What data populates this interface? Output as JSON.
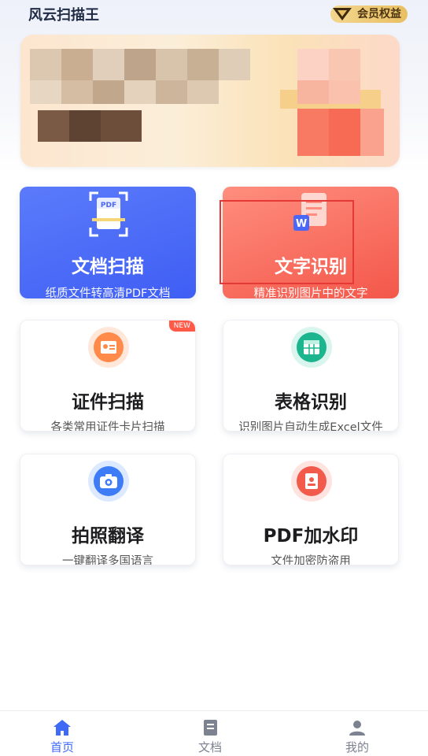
{
  "header": {
    "app_title": "风云扫描王",
    "vip_label": "会员权益"
  },
  "colors": {
    "accent_blue": "#3f5ef4",
    "accent_red": "#f3574a",
    "tab_active": "#3f6af5",
    "tab_inactive": "#7d8290"
  },
  "cards": [
    {
      "title": "文档扫描",
      "subtitle": "纸质文件转高清PDF文档",
      "icon": "pdf-scan-icon",
      "pdf_tag": "PDF"
    },
    {
      "title": "文字识别",
      "subtitle": "精准识别图片中的文字",
      "icon": "word-doc-icon",
      "word_tag": "W"
    },
    {
      "title": "证件扫描",
      "subtitle": "各类常用证件卡片扫描",
      "icon": "id-card-icon",
      "badge": "NEW"
    },
    {
      "title": "表格识别",
      "subtitle": "识别图片自动生成Excel文件",
      "icon": "table-icon"
    },
    {
      "title": "拍照翻译",
      "subtitle": "一键翻译多国语言",
      "icon": "camera-translate-icon"
    },
    {
      "title": "PDF加水印",
      "subtitle": "文件加密防盗用",
      "icon": "watermark-icon"
    }
  ],
  "tabbar": {
    "items": [
      {
        "label": "首页",
        "icon": "home-icon",
        "active": true
      },
      {
        "label": "文档",
        "icon": "document-icon",
        "active": false
      },
      {
        "label": "我的",
        "icon": "user-icon",
        "active": false
      }
    ]
  }
}
